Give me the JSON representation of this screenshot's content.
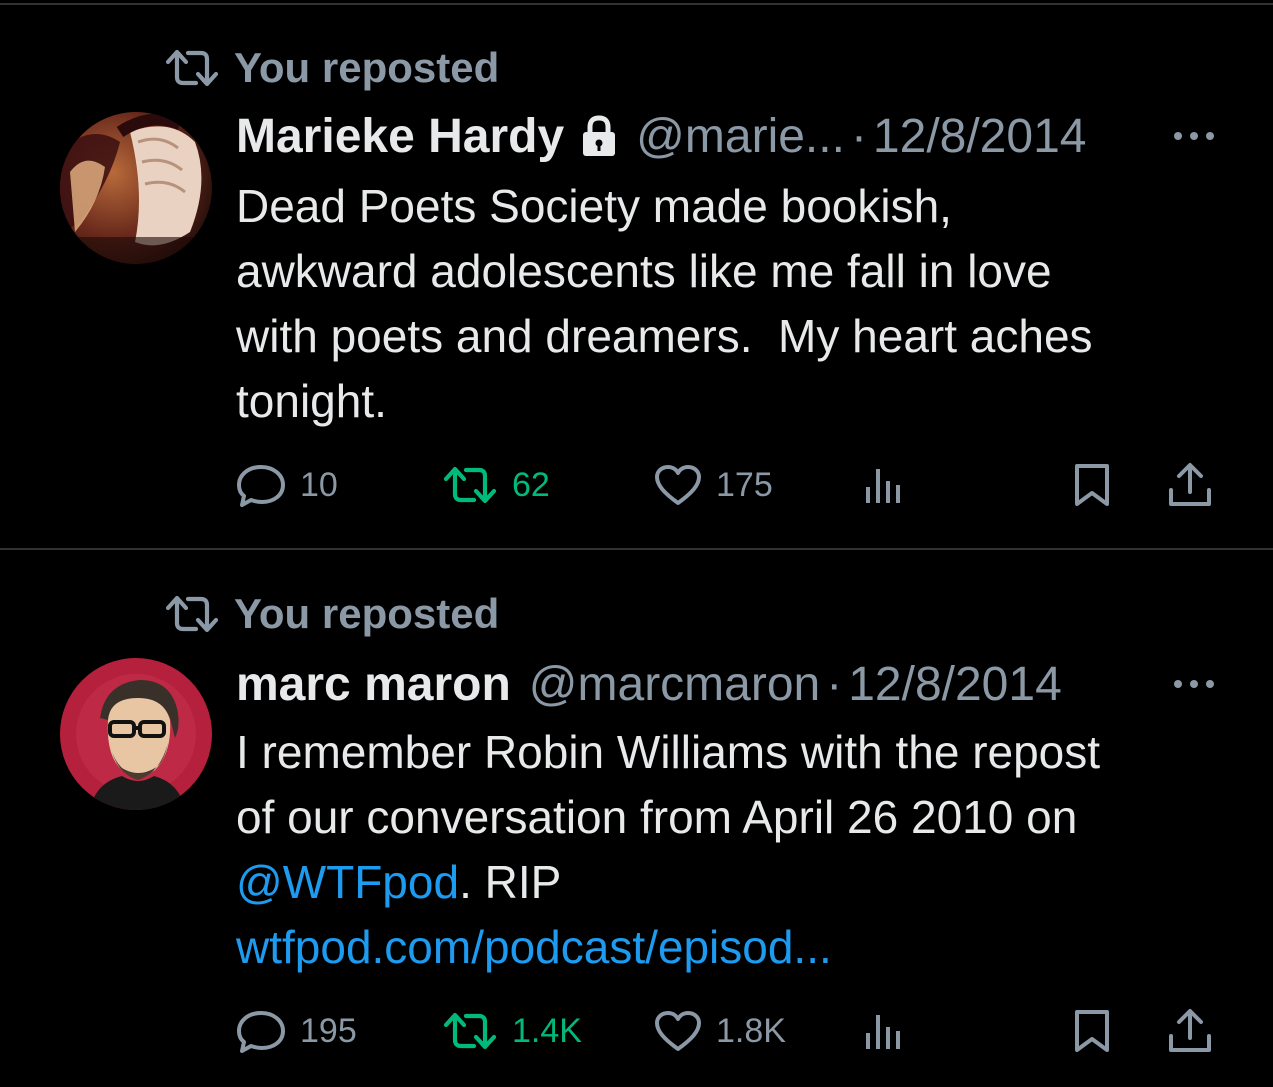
{
  "colors": {
    "background": "#000000",
    "text_primary": "#e7e9ea",
    "text_secondary": "#8b98a5",
    "link": "#1d9bf0",
    "retweeted": "#00ba7c",
    "divider": "#2f3336"
  },
  "tweets": [
    {
      "repost_label": "You reposted",
      "display_name": "Marieke Hardy",
      "verified_lock": true,
      "handle": "@marie...",
      "separator": "·",
      "date": "12/8/2014",
      "avatar": "portrait-photo",
      "text_lines": [
        "Dead Poets Society made bookish,",
        "awkward adolescents like me fall in love",
        "with poets and dreamers.  My heart aches",
        "tonight."
      ],
      "stats": {
        "replies": "10",
        "reposts": "62",
        "likes": "175"
      }
    },
    {
      "repost_label": "You reposted",
      "display_name": "marc maron",
      "handle": "@marcmaron",
      "separator": "·",
      "date": "12/8/2014",
      "avatar": "illustrated-portrait",
      "text_lines": [
        "I remember Robin Williams with the repost",
        "of our conversation from April 26 2010 on"
      ],
      "mention": "@WTFpod",
      "mention_suffix": ". RIP",
      "url": "wtfpod.com/podcast/episod...",
      "stats": {
        "replies": "195",
        "reposts": "1.4K",
        "likes": "1.8K"
      }
    }
  ],
  "icons": {
    "repost": "repost-icon",
    "lock": "lock-icon",
    "more": "more-icon",
    "reply": "reply-icon",
    "like": "heart-icon",
    "views": "views-icon",
    "bookmark": "bookmark-icon",
    "share": "share-icon"
  }
}
